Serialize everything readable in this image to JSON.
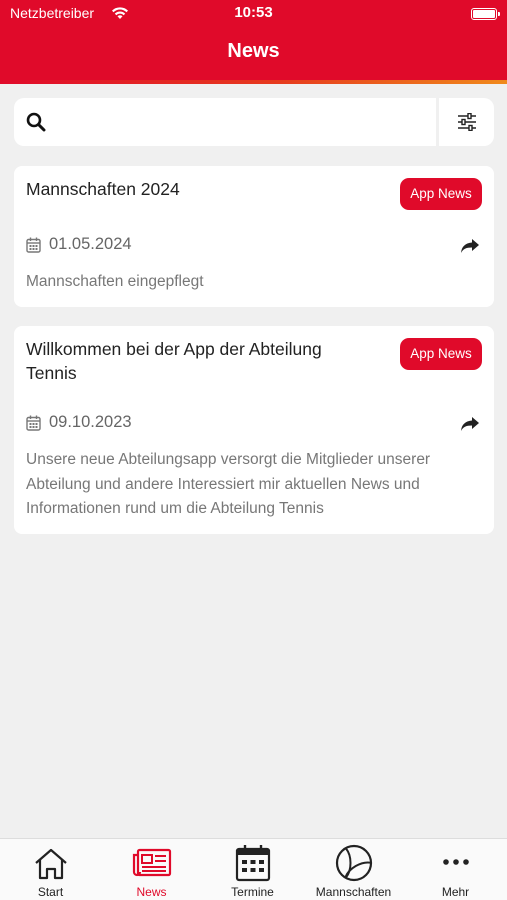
{
  "status_bar": {
    "carrier": "Netzbetreiber",
    "time": "10:53"
  },
  "header": {
    "title": "News"
  },
  "search": {
    "placeholder": "",
    "value": ""
  },
  "news": [
    {
      "title": "Mannschaften 2024",
      "badge": "App News",
      "date": "01.05.2024",
      "description": "Mannschaften eingepflegt"
    },
    {
      "title": "Willkommen bei der App der Abteilung Tennis",
      "badge": "App News",
      "date": "09.10.2023",
      "description": "Unsere neue Abteilungsapp versorgt die Mitglieder unserer Abteilung und andere Interessiert mir aktuellen News und Informationen rund um die Abteilung Tennis"
    }
  ],
  "tabs": [
    {
      "label": "Start",
      "icon": "home-icon"
    },
    {
      "label": "News",
      "icon": "newspaper-icon",
      "active": true
    },
    {
      "label": "Termine",
      "icon": "calendar-icon"
    },
    {
      "label": "Mannschaften",
      "icon": "tennis-ball-icon"
    },
    {
      "label": "Mehr",
      "icon": "more-icon"
    }
  ],
  "colors": {
    "primary": "#e00a2a",
    "accent": "#f08a1c",
    "background": "#f0f0f0"
  }
}
